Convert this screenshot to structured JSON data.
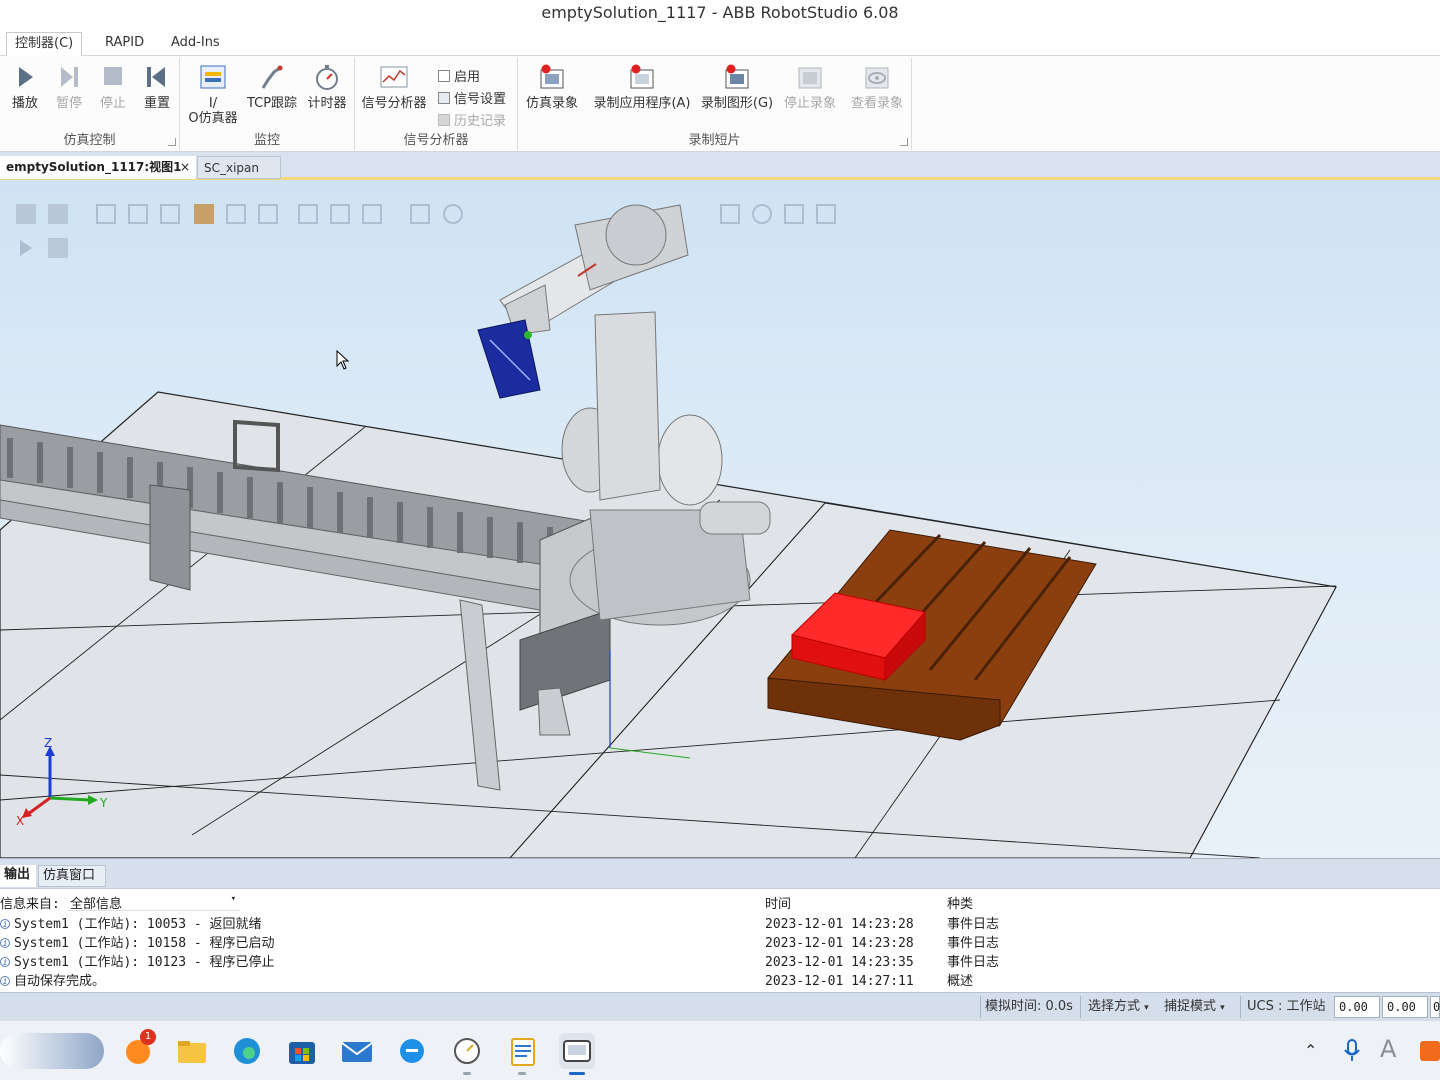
{
  "window": {
    "title": "emptySolution_1117 - ABB RobotStudio 6.08"
  },
  "ribbon_tabs": [
    {
      "label": "控制器(C)"
    },
    {
      "label": "RAPID"
    },
    {
      "label": "Add-Ins"
    }
  ],
  "ribbon": {
    "sim_control": {
      "label": "仿真控制",
      "play": "播放",
      "pause": "暂停",
      "stop": "停止",
      "reset": "重置"
    },
    "monitor": {
      "label": "监控",
      "io_sim_line1": "I/",
      "io_sim_line2": "O仿真器",
      "tcp_trace": "TCP跟踪",
      "timer": "计时器"
    },
    "signal_analyzer": {
      "label": "信号分析器",
      "analyzer": "信号分析器",
      "enable": "启用",
      "signal_settings": "信号设置",
      "history": "历史记录"
    },
    "record": {
      "label": "录制短片",
      "sim_record": "仿真录象",
      "record_app": "录制应用程序(A)",
      "record_graphics": "录制图形(G)",
      "stop_record": "停止录象",
      "view_record": "查看录象"
    }
  },
  "doc_tabs": [
    {
      "label": "emptySolution_1117:视图1",
      "close": "×"
    },
    {
      "label": "SC_xipan"
    }
  ],
  "viewport": {
    "axes": {
      "x": "X",
      "y": "Y",
      "z": "Z"
    }
  },
  "output": {
    "tabs": [
      {
        "label": "输出"
      },
      {
        "label": "仿真窗口"
      }
    ],
    "filter_label": "信息来自:",
    "filter_value": "全部信息",
    "col_time": "时间",
    "col_type": "种类",
    "rows": [
      {
        "message": "System1 (工作站): 10053 - 返回就绪",
        "time": "2023-12-01 14:23:28",
        "type": "事件日志"
      },
      {
        "message": "System1 (工作站): 10158 - 程序已启动",
        "time": "2023-12-01 14:23:28",
        "type": "事件日志"
      },
      {
        "message": "System1 (工作站): 10123 - 程序已停止",
        "time": "2023-12-01 14:23:35",
        "type": "事件日志"
      },
      {
        "message": "自动保存完成。",
        "time": "2023-12-01 14:27:11",
        "type": "概述"
      }
    ]
  },
  "statusbar": {
    "sim_time": "模拟时间: 0.0s",
    "select_mode": "选择方式",
    "snap_mode": "捕捉模式",
    "ucs": "UCS : 工作站",
    "coord1": "0.00",
    "coord2": "0.00",
    "coord3": "0"
  },
  "taskbar": {
    "mail_badge": "1"
  },
  "colors": {
    "accent": "#1a66c9",
    "pallet": "#8b3f0f",
    "box": "#ff1a1a",
    "viewport_top": "#cfe3f4",
    "viewport_bottom": "#e9f1f9"
  }
}
